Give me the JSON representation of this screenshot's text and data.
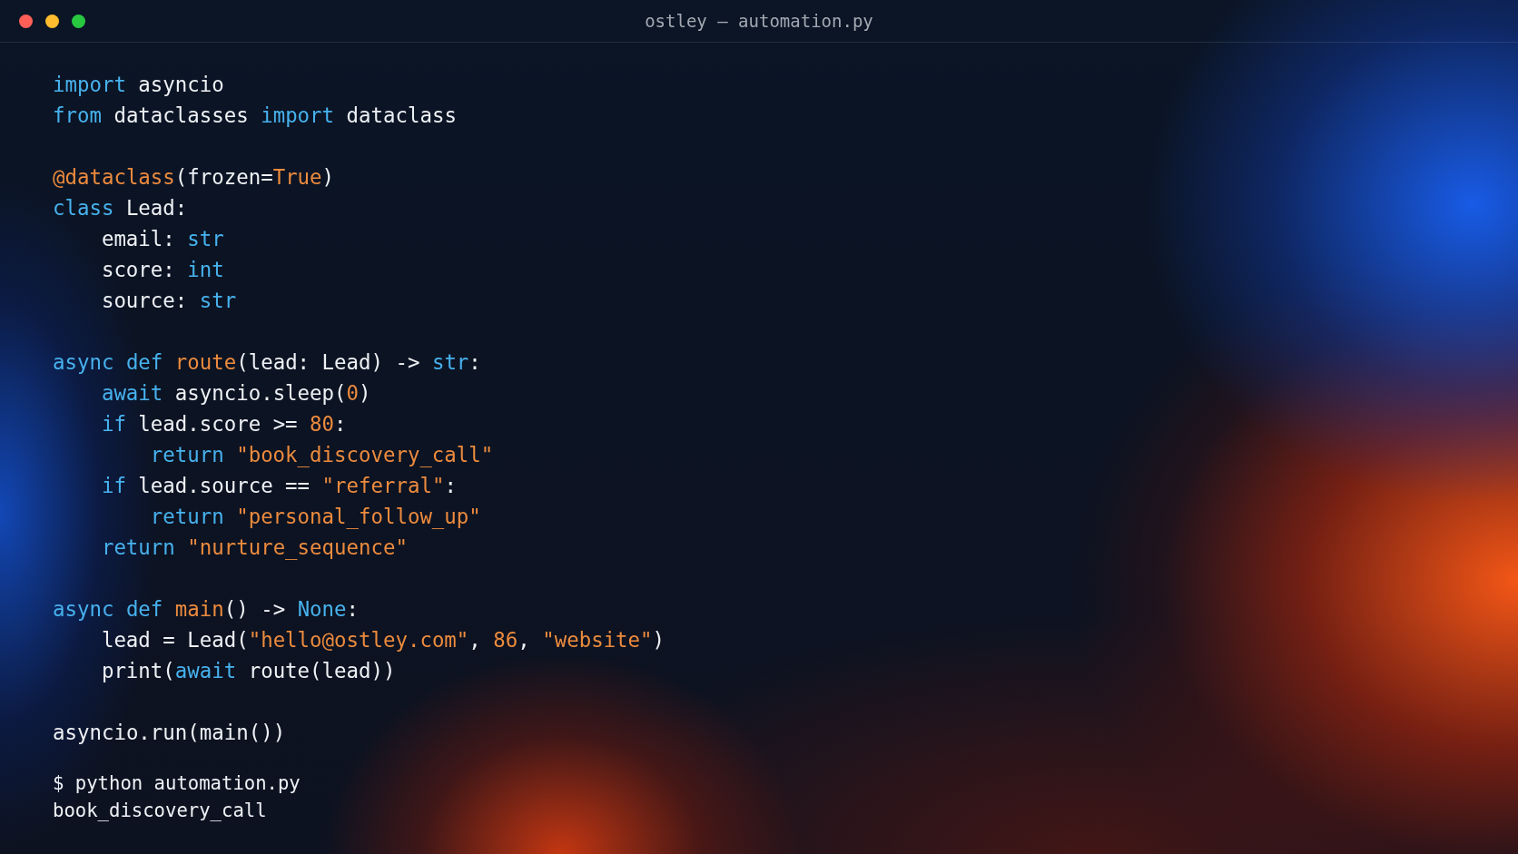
{
  "window": {
    "title": "ostley — automation.py"
  },
  "code": {
    "blocks": [
      [
        {
          "tokens": [
            {
              "kind": "keyword",
              "text": "import"
            },
            {
              "kind": "plain",
              "text": " asyncio"
            }
          ]
        },
        {
          "tokens": [
            {
              "kind": "keyword",
              "text": "from"
            },
            {
              "kind": "plain",
              "text": " dataclasses "
            },
            {
              "kind": "keyword",
              "text": "import"
            },
            {
              "kind": "plain",
              "text": " dataclass"
            }
          ]
        }
      ],
      [
        {
          "tokens": [
            {
              "kind": "decorator",
              "text": "@dataclass"
            },
            {
              "kind": "plain",
              "text": "(frozen="
            },
            {
              "kind": "constant",
              "text": "True"
            },
            {
              "kind": "plain",
              "text": ")"
            }
          ]
        },
        {
          "tokens": [
            {
              "kind": "keyword",
              "text": "class"
            },
            {
              "kind": "plain",
              "text": " Lead:"
            }
          ],
          "children": [
            {
              "tokens": [
                {
                  "kind": "plain",
                  "text": "email: "
                },
                {
                  "kind": "keyword",
                  "text": "str"
                }
              ]
            },
            {
              "tokens": [
                {
                  "kind": "plain",
                  "text": "score: "
                },
                {
                  "kind": "keyword",
                  "text": "int"
                }
              ]
            },
            {
              "tokens": [
                {
                  "kind": "plain",
                  "text": "source: "
                },
                {
                  "kind": "keyword",
                  "text": "str"
                }
              ]
            }
          ]
        }
      ],
      [
        {
          "tokens": [
            {
              "kind": "keyword",
              "text": "async def"
            },
            {
              "kind": "function",
              "text": " route"
            },
            {
              "kind": "plain",
              "text": "(lead: Lead) -> "
            },
            {
              "kind": "keyword",
              "text": "str"
            },
            {
              "kind": "plain",
              "text": ":"
            }
          ],
          "children": [
            {
              "tokens": [
                {
                  "kind": "keyword",
                  "text": "await"
                },
                {
                  "kind": "plain",
                  "text": " asyncio.sleep("
                },
                {
                  "kind": "number",
                  "text": "0"
                },
                {
                  "kind": "plain",
                  "text": ")"
                }
              ]
            },
            {
              "tokens": [
                {
                  "kind": "keyword",
                  "text": "if"
                },
                {
                  "kind": "plain",
                  "text": " lead.score >= "
                },
                {
                  "kind": "number",
                  "text": "80"
                },
                {
                  "kind": "plain",
                  "text": ":"
                }
              ],
              "children": [
                {
                  "tokens": [
                    {
                      "kind": "keyword",
                      "text": "return"
                    },
                    {
                      "kind": "string",
                      "text": " \"book_discovery_call\""
                    }
                  ]
                }
              ]
            },
            {
              "tokens": [
                {
                  "kind": "keyword",
                  "text": "if"
                },
                {
                  "kind": "plain",
                  "text": " lead.source == "
                },
                {
                  "kind": "string",
                  "text": "\"referral\""
                },
                {
                  "kind": "plain",
                  "text": ":"
                }
              ],
              "children": [
                {
                  "tokens": [
                    {
                      "kind": "keyword",
                      "text": "return"
                    },
                    {
                      "kind": "string",
                      "text": " \"personal_follow_up\""
                    }
                  ]
                }
              ]
            },
            {
              "tokens": [
                {
                  "kind": "keyword",
                  "text": "return"
                },
                {
                  "kind": "string",
                  "text": " \"nurture_sequence\""
                }
              ]
            }
          ]
        }
      ],
      [
        {
          "tokens": [
            {
              "kind": "keyword",
              "text": "async def"
            },
            {
              "kind": "function",
              "text": " main"
            },
            {
              "kind": "plain",
              "text": "() -> "
            },
            {
              "kind": "keyword",
              "text": "None"
            },
            {
              "kind": "plain",
              "text": ":"
            }
          ],
          "children": [
            {
              "tokens": [
                {
                  "kind": "plain",
                  "text": "lead = Lead("
                },
                {
                  "kind": "string",
                  "text": "\"hello@ostley.com\""
                },
                {
                  "kind": "plain",
                  "text": ", "
                },
                {
                  "kind": "number",
                  "text": "86"
                },
                {
                  "kind": "plain",
                  "text": ", "
                },
                {
                  "kind": "string",
                  "text": "\"website\""
                },
                {
                  "kind": "plain",
                  "text": ")"
                }
              ]
            },
            {
              "tokens": [
                {
                  "kind": "plain",
                  "text": "print("
                },
                {
                  "kind": "keyword",
                  "text": "await"
                },
                {
                  "kind": "plain",
                  "text": " route(lead))"
                }
              ]
            }
          ]
        }
      ],
      [
        {
          "tokens": [
            {
              "kind": "plain",
              "text": "asyncio.run(main())"
            }
          ]
        }
      ]
    ]
  },
  "terminal": {
    "command": "$ python automation.py",
    "output": "book_discovery_call"
  }
}
